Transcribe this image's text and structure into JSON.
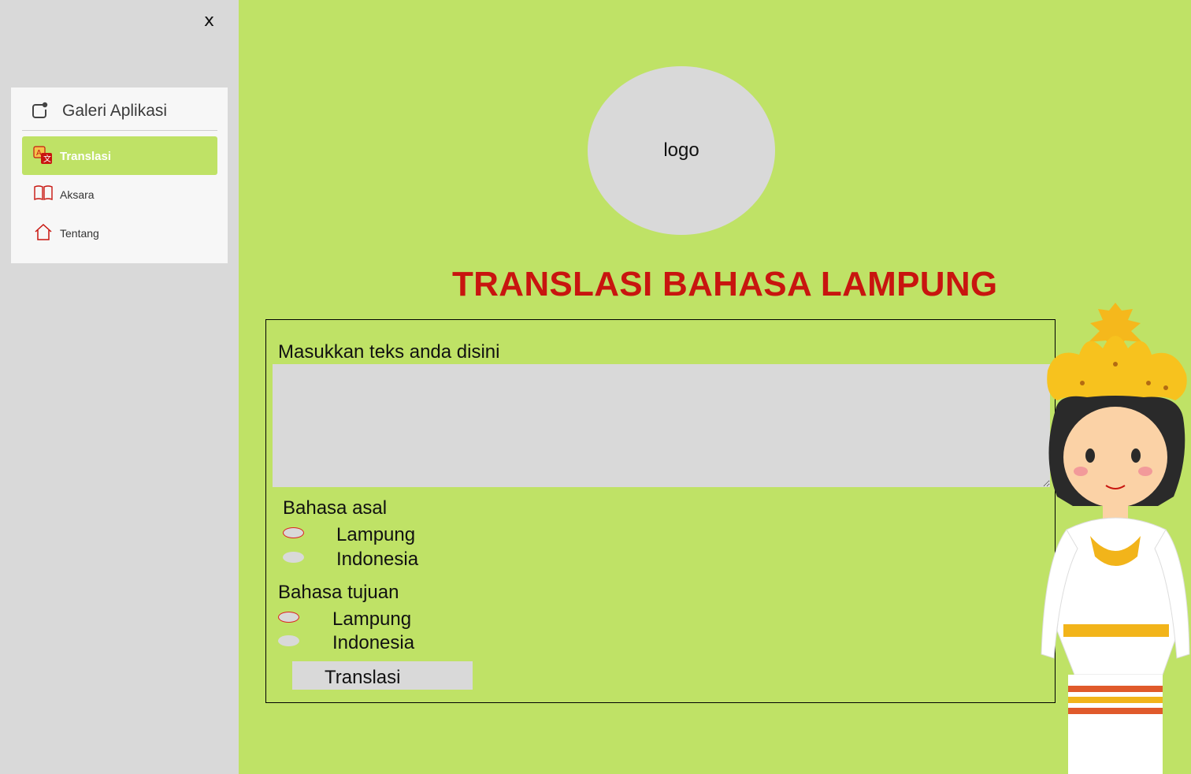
{
  "drawer": {
    "close_label": "x",
    "header_label": "Galeri Aplikasi",
    "items": [
      {
        "label": "Translasi",
        "icon": "translate-icon",
        "active": true
      },
      {
        "label": "Aksara",
        "icon": "book-icon",
        "active": false
      },
      {
        "label": "Tentang",
        "icon": "home-icon",
        "active": false
      }
    ]
  },
  "main": {
    "logo_label": "logo",
    "title": "TRANSLASI BAHASA LAMPUNG",
    "input_label": "Masukkan teks anda disini",
    "input_value": "",
    "source_group": {
      "label": "Bahasa asal",
      "options": [
        "Lampung",
        "Indonesia"
      ],
      "selected": "Lampung"
    },
    "target_group": {
      "label": "Bahasa tujuan",
      "options": [
        "Lampung",
        "Indonesia"
      ],
      "selected": "Lampung"
    },
    "button_label": "Translasi"
  },
  "colors": {
    "background": "#bfe266",
    "drawer": "#d9d9d9",
    "title": "#c8150f",
    "accent": "#bfe266"
  }
}
